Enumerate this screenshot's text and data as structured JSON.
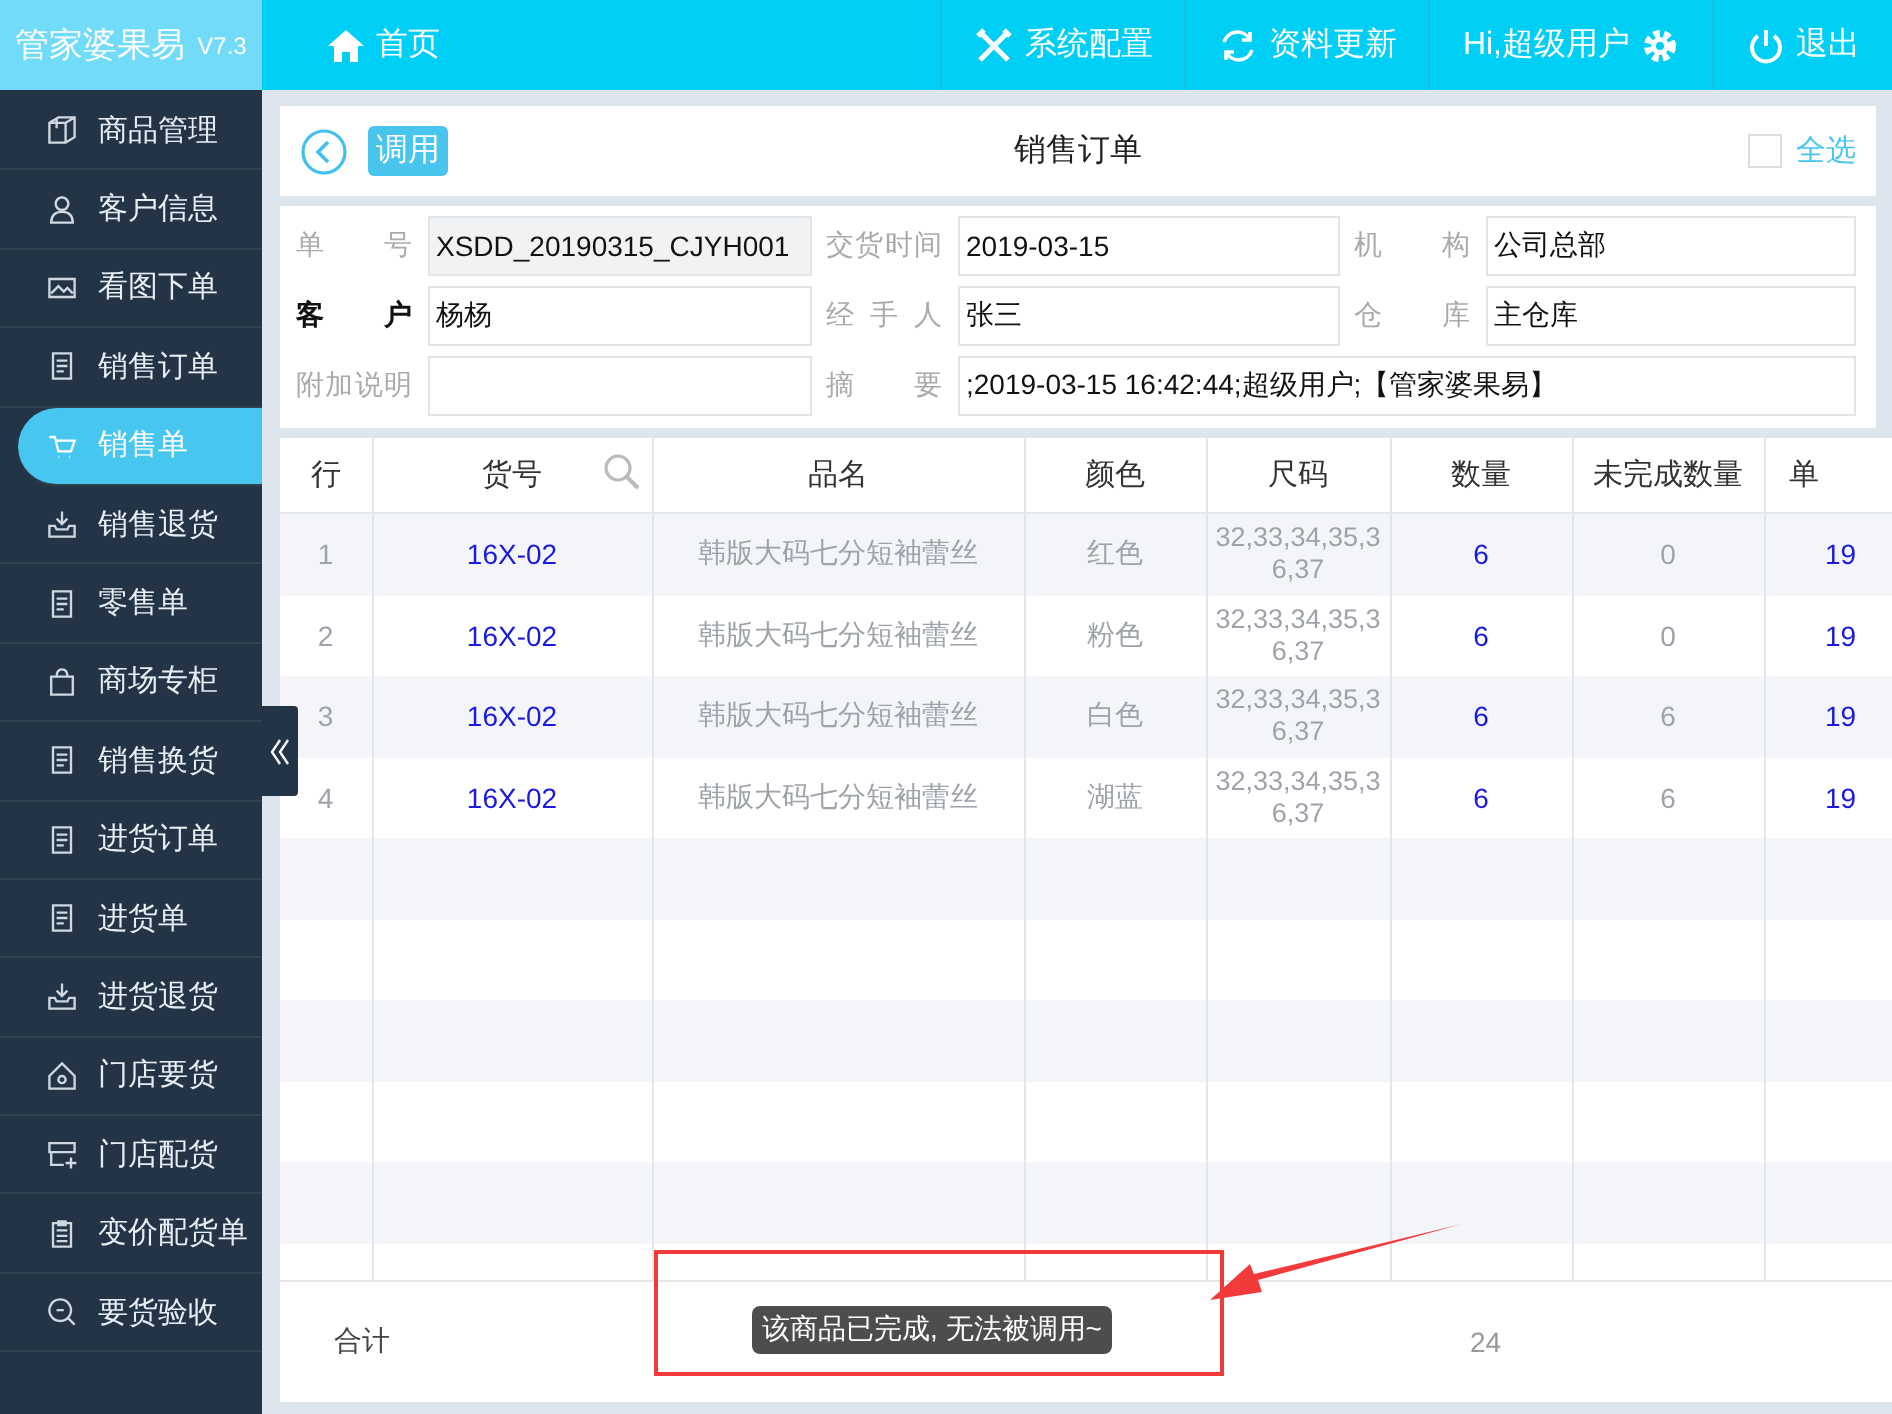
{
  "app": {
    "name": "管家婆果易",
    "version": "V7.3"
  },
  "topnav": [
    {
      "kind": "home",
      "label": "首页"
    },
    {
      "kind": "settings",
      "label": "系统配置"
    },
    {
      "kind": "refresh",
      "label": "资料更新"
    },
    {
      "kind": "user",
      "label": "Hi,超级用户"
    },
    {
      "kind": "logout",
      "label": "退出"
    }
  ],
  "sidebar": {
    "items": [
      {
        "label": "商品管理",
        "selected": false
      },
      {
        "label": "客户信息",
        "selected": false
      },
      {
        "label": "看图下单",
        "selected": false
      },
      {
        "label": "销售订单",
        "selected": false
      },
      {
        "label": "销售单",
        "selected": true
      },
      {
        "label": "销售退货",
        "selected": false
      },
      {
        "label": "零售单",
        "selected": false
      },
      {
        "label": "商场专柜",
        "selected": false
      },
      {
        "label": "销售换货",
        "selected": false
      },
      {
        "label": "进货订单",
        "selected": false
      },
      {
        "label": "进货单",
        "selected": false
      },
      {
        "label": "进货退货",
        "selected": false
      },
      {
        "label": "门店要货",
        "selected": false
      },
      {
        "label": "门店配货",
        "selected": false
      },
      {
        "label": "变价配货单",
        "selected": false
      },
      {
        "label": "要货验收",
        "selected": false
      }
    ]
  },
  "page": {
    "action": "调用",
    "title": "销售订单",
    "select_all": {
      "label": "全选",
      "checked": false
    }
  },
  "form": [
    {
      "label": "单号",
      "value": "XSDD_20190315_CJYH001",
      "readonly": true,
      "required": false
    },
    {
      "label": "交货时间",
      "value": "2019-03-15",
      "readonly": false,
      "required": false
    },
    {
      "label": "机构",
      "value": "公司总部",
      "readonly": false,
      "required": false
    },
    {
      "label": "客户",
      "value": "杨杨",
      "readonly": false,
      "required": true
    },
    {
      "label": "经手人",
      "value": "张三",
      "readonly": false,
      "required": false
    },
    {
      "label": "仓库",
      "value": "主仓库",
      "readonly": false,
      "required": false
    },
    {
      "label": "附加说明",
      "readonly": false,
      "required": false
    },
    {
      "label": "摘要",
      "value": ";2019-03-15 16:42:44;超级用户;【管家婆果易】",
      "readonly": false,
      "required": false,
      "wide": true
    }
  ],
  "table": {
    "columns": [
      {
        "label": "行",
        "emphasis": false
      },
      {
        "label": "货号",
        "emphasis": true,
        "searchable": true
      },
      {
        "label": "品名",
        "emphasis": false
      },
      {
        "label": "颜色",
        "emphasis": false
      },
      {
        "label": "尺码",
        "emphasis": false
      },
      {
        "label": "数量",
        "emphasis": true
      },
      {
        "label": "未完成数量",
        "emphasis": false
      },
      {
        "label": "单",
        "emphasis": true
      }
    ],
    "rows": [
      [
        "1",
        "16X-02",
        "韩版大码七分短袖蕾丝",
        "红色",
        "32,33,34,35,36,37",
        "6",
        "0",
        "19"
      ],
      [
        "2",
        "16X-02",
        "韩版大码七分短袖蕾丝",
        "粉色",
        "32,33,34,35,36,37",
        "6",
        "0",
        "19"
      ],
      [
        "3",
        "16X-02",
        "韩版大码七分短袖蕾丝",
        "白色",
        "32,33,34,35,36,37",
        "6",
        "6",
        "19"
      ],
      [
        "4",
        "16X-02",
        "韩版大码七分短袖蕾丝",
        "湖蓝",
        "32,33,34,35,36,37",
        "6",
        "6",
        "19"
      ]
    ],
    "footer": {
      "label": "合计",
      "quantity_total": "24"
    }
  },
  "toast": "该商品已完成, 无法被调用~"
}
